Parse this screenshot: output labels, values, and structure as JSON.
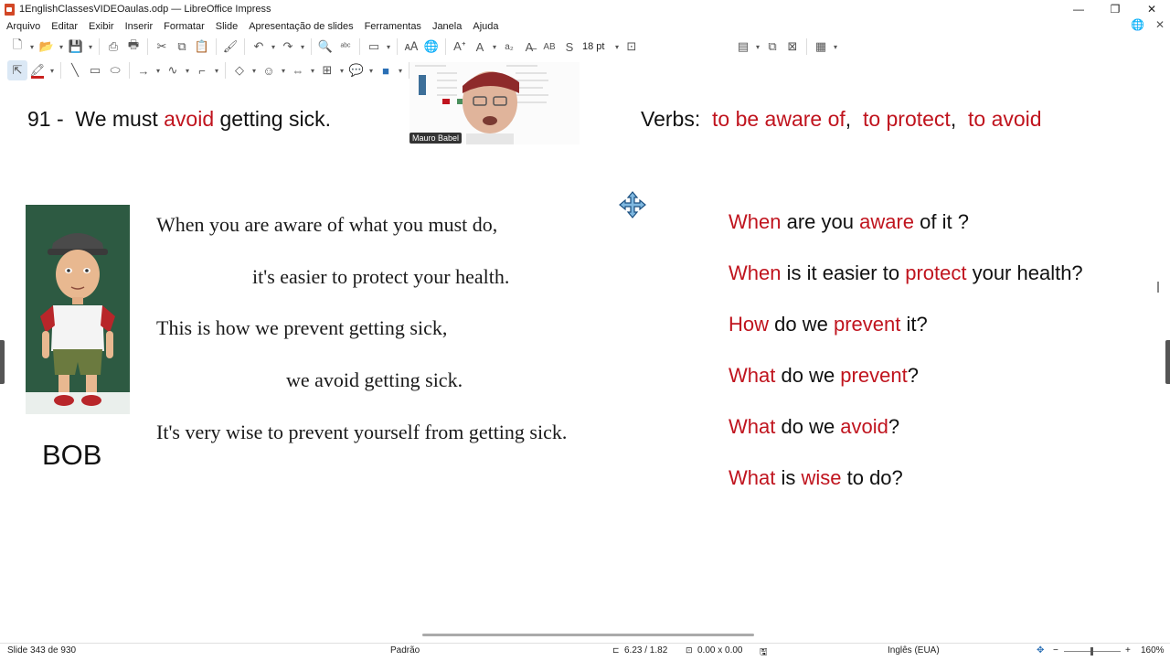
{
  "window": {
    "title": "1EnglishClassesVIDEOaulas.odp — LibreOffice Impress",
    "controls": [
      "—",
      "❐",
      "✕"
    ]
  },
  "menu": [
    "Arquivo",
    "Editar",
    "Exibir",
    "Inserir",
    "Formatar",
    "Slide",
    "Apresentação de slides",
    "Ferramentas",
    "Janela",
    "Ajuda"
  ],
  "toolbar": {
    "font_size": "18 pt"
  },
  "slide": {
    "heading": {
      "number": "91 -",
      "pre": "We must",
      "verb": "avoid",
      "post": "getting sick."
    },
    "verbs": {
      "label": "Verbs:",
      "v1": "to be aware of",
      "sep1": ",",
      "v2": "to protect",
      "sep2": ",",
      "v3": "to avoid"
    },
    "character_name": "BOB",
    "passage": [
      "When you are aware of what you must do,",
      "it's easier to protect your health.",
      "This is how we prevent getting sick,",
      "we avoid getting sick.",
      "It's very wise to prevent yourself from getting sick."
    ],
    "questions": [
      {
        "a": "When",
        "b": " are you ",
        "c": "aware",
        "d": " of it ?"
      },
      {
        "a": "When",
        "b": " is it easier to ",
        "c": "protect",
        "d": " your health?"
      },
      {
        "a": "How",
        "b": " do we ",
        "c": "prevent",
        "d": " it?"
      },
      {
        "a": "What",
        "b": " do we ",
        "c": "prevent",
        "d": "?"
      },
      {
        "a": "What",
        "b": " do we ",
        "c": "avoid",
        "d": "?"
      },
      {
        "a": "What",
        "b": " is ",
        "c": "wise",
        "d": " to do?"
      }
    ]
  },
  "webcam": {
    "name": "Mauro Babel"
  },
  "status": {
    "slide": "Slide 343 de 930",
    "layout": "Padrão",
    "position": "6.23 / 1.82",
    "size": "0.00 x 0.00",
    "language": "Inglês (EUA)",
    "zoom": "160%"
  },
  "colors": {
    "accent_red": "#c0141e",
    "bob_bg": "#2d5a42"
  }
}
